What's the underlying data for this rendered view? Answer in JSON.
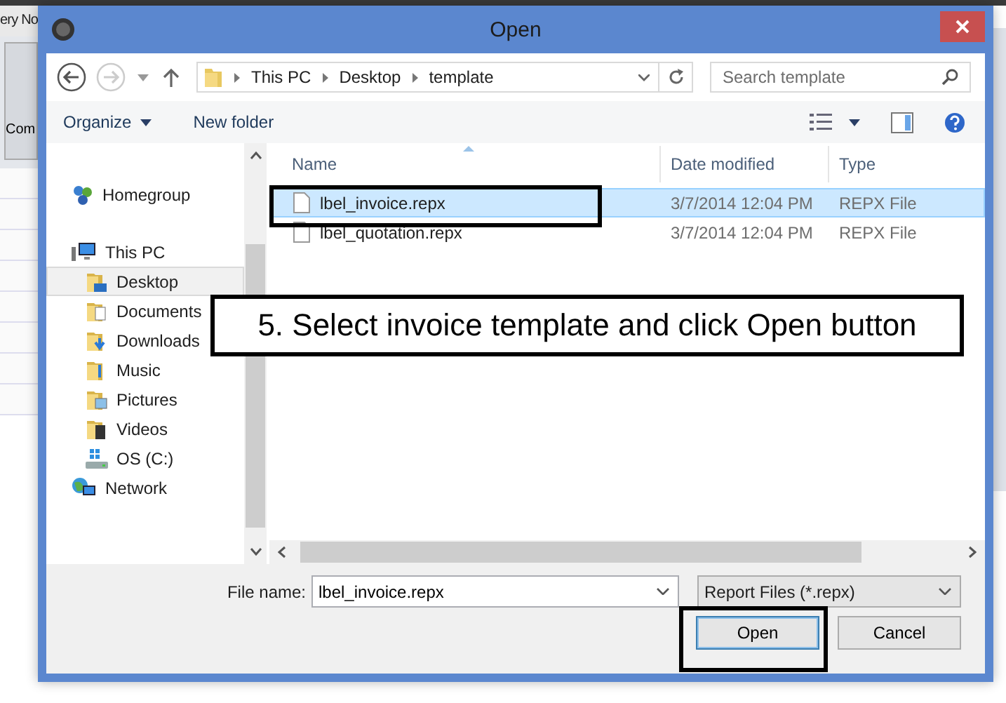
{
  "background_app": {
    "title_fragment": "ery No",
    "toolbar_button": "Com"
  },
  "dialog": {
    "title": "Open",
    "address": {
      "path": [
        "This PC",
        "Desktop",
        "template"
      ]
    },
    "search": {
      "placeholder": "Search template"
    },
    "commands": [
      {
        "label": "Organize",
        "dropdown": true
      },
      {
        "label": "New folder",
        "dropdown": false
      }
    ],
    "navigation_pane": [
      {
        "label": "Homegroup",
        "kind": "homegroup",
        "selected": false
      },
      {
        "label": "This PC",
        "kind": "computer",
        "selected": false,
        "children": [
          {
            "label": "Desktop",
            "kind": "desktop",
            "selected": true
          },
          {
            "label": "Documents",
            "kind": "documents",
            "selected": false
          },
          {
            "label": "Downloads",
            "kind": "downloads",
            "selected": false
          },
          {
            "label": "Music",
            "kind": "music",
            "selected": false
          },
          {
            "label": "Pictures",
            "kind": "pictures",
            "selected": false
          },
          {
            "label": "Videos",
            "kind": "videos",
            "selected": false
          },
          {
            "label": "OS (C:)",
            "kind": "drive",
            "selected": false
          }
        ]
      },
      {
        "label": "Network",
        "kind": "network",
        "selected": false
      }
    ],
    "columns": [
      "Name",
      "Date modified",
      "Type"
    ],
    "files": [
      {
        "name": "lbel_invoice.repx",
        "date_modified": "3/7/2014 12:04 PM",
        "type": "REPX File",
        "selected": true
      },
      {
        "name": "lbel_quotation.repx",
        "date_modified": "3/7/2014 12:04 PM",
        "type": "REPX File",
        "selected": false
      }
    ],
    "file_name": {
      "label": "File name:",
      "value": "lbel_invoice.repx"
    },
    "file_type": {
      "value": "Report Files (*.repx)"
    },
    "buttons": [
      {
        "label": "Open",
        "default": true
      },
      {
        "label": "Cancel",
        "default": false
      }
    ]
  },
  "callout": {
    "text": "5. Select invoice template and click Open button"
  }
}
